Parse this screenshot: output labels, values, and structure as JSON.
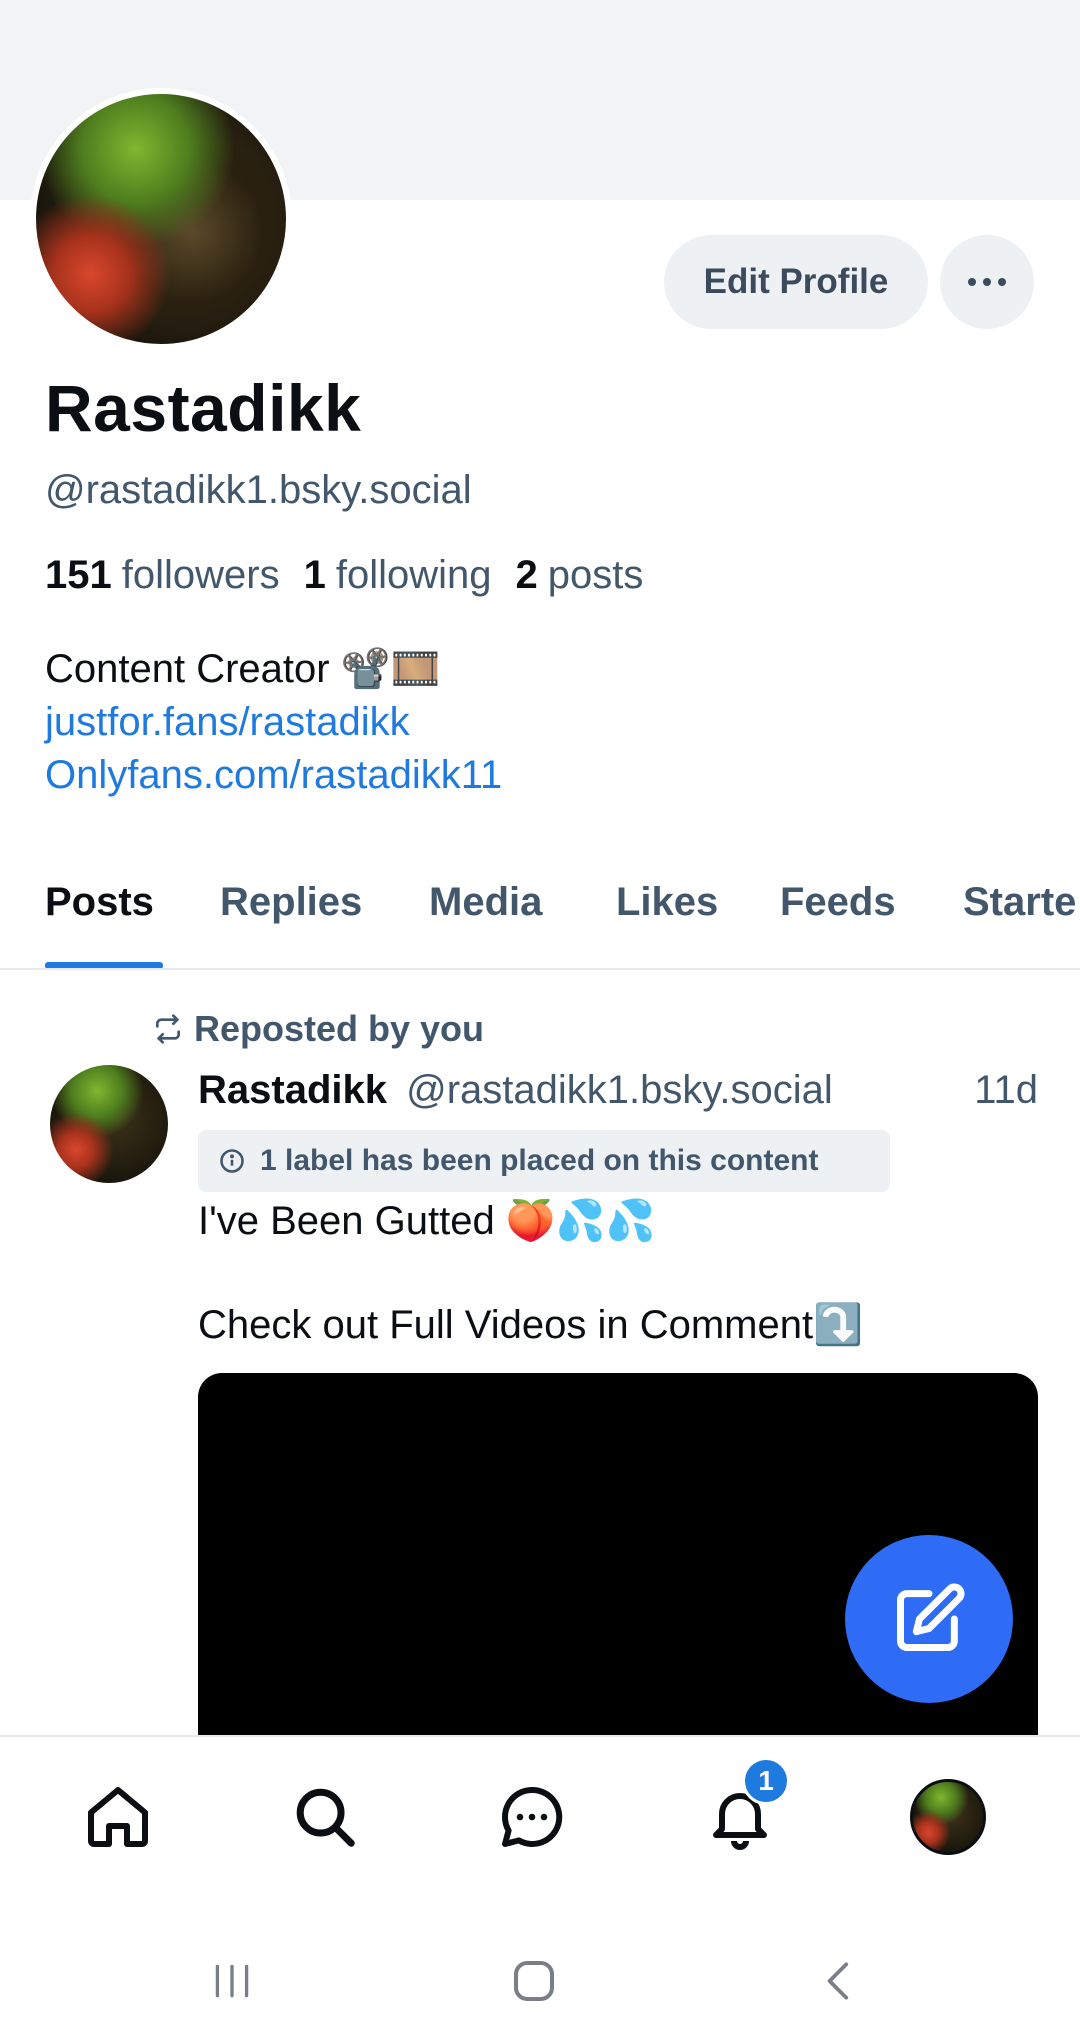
{
  "profile": {
    "display_name": "Rastadikk",
    "handle": "@rastadikk1.bsky.social",
    "followers_count": "151",
    "followers_label": "followers",
    "following_count": "1",
    "following_label": "following",
    "posts_count": "2",
    "posts_label": "posts",
    "bio_line1": "Content Creator 📽️🎞️",
    "bio_link1": "justfor.fans/rastadikk",
    "bio_link2": "Onlyfans.com/rastadikk11",
    "edit_label": "Edit Profile"
  },
  "tabs": [
    {
      "label": "Posts"
    },
    {
      "label": "Replies"
    },
    {
      "label": "Media"
    },
    {
      "label": "Likes"
    },
    {
      "label": "Feeds"
    },
    {
      "label": "Starte"
    }
  ],
  "post": {
    "repost_label": "Reposted by you",
    "author_name": "Rastadikk",
    "author_handle": "@rastadikk1.bsky.social",
    "time": "11d",
    "label_notice": "1 label has been placed on this content",
    "text": "I've Been Gutted 🍑💦💦\n\nCheck out Full Videos in Comment⤵️"
  },
  "notifications": {
    "badge": "1"
  },
  "colors": {
    "accent": "#1f7ae0",
    "fab": "#2f6cf5",
    "muted": "#42576c"
  }
}
